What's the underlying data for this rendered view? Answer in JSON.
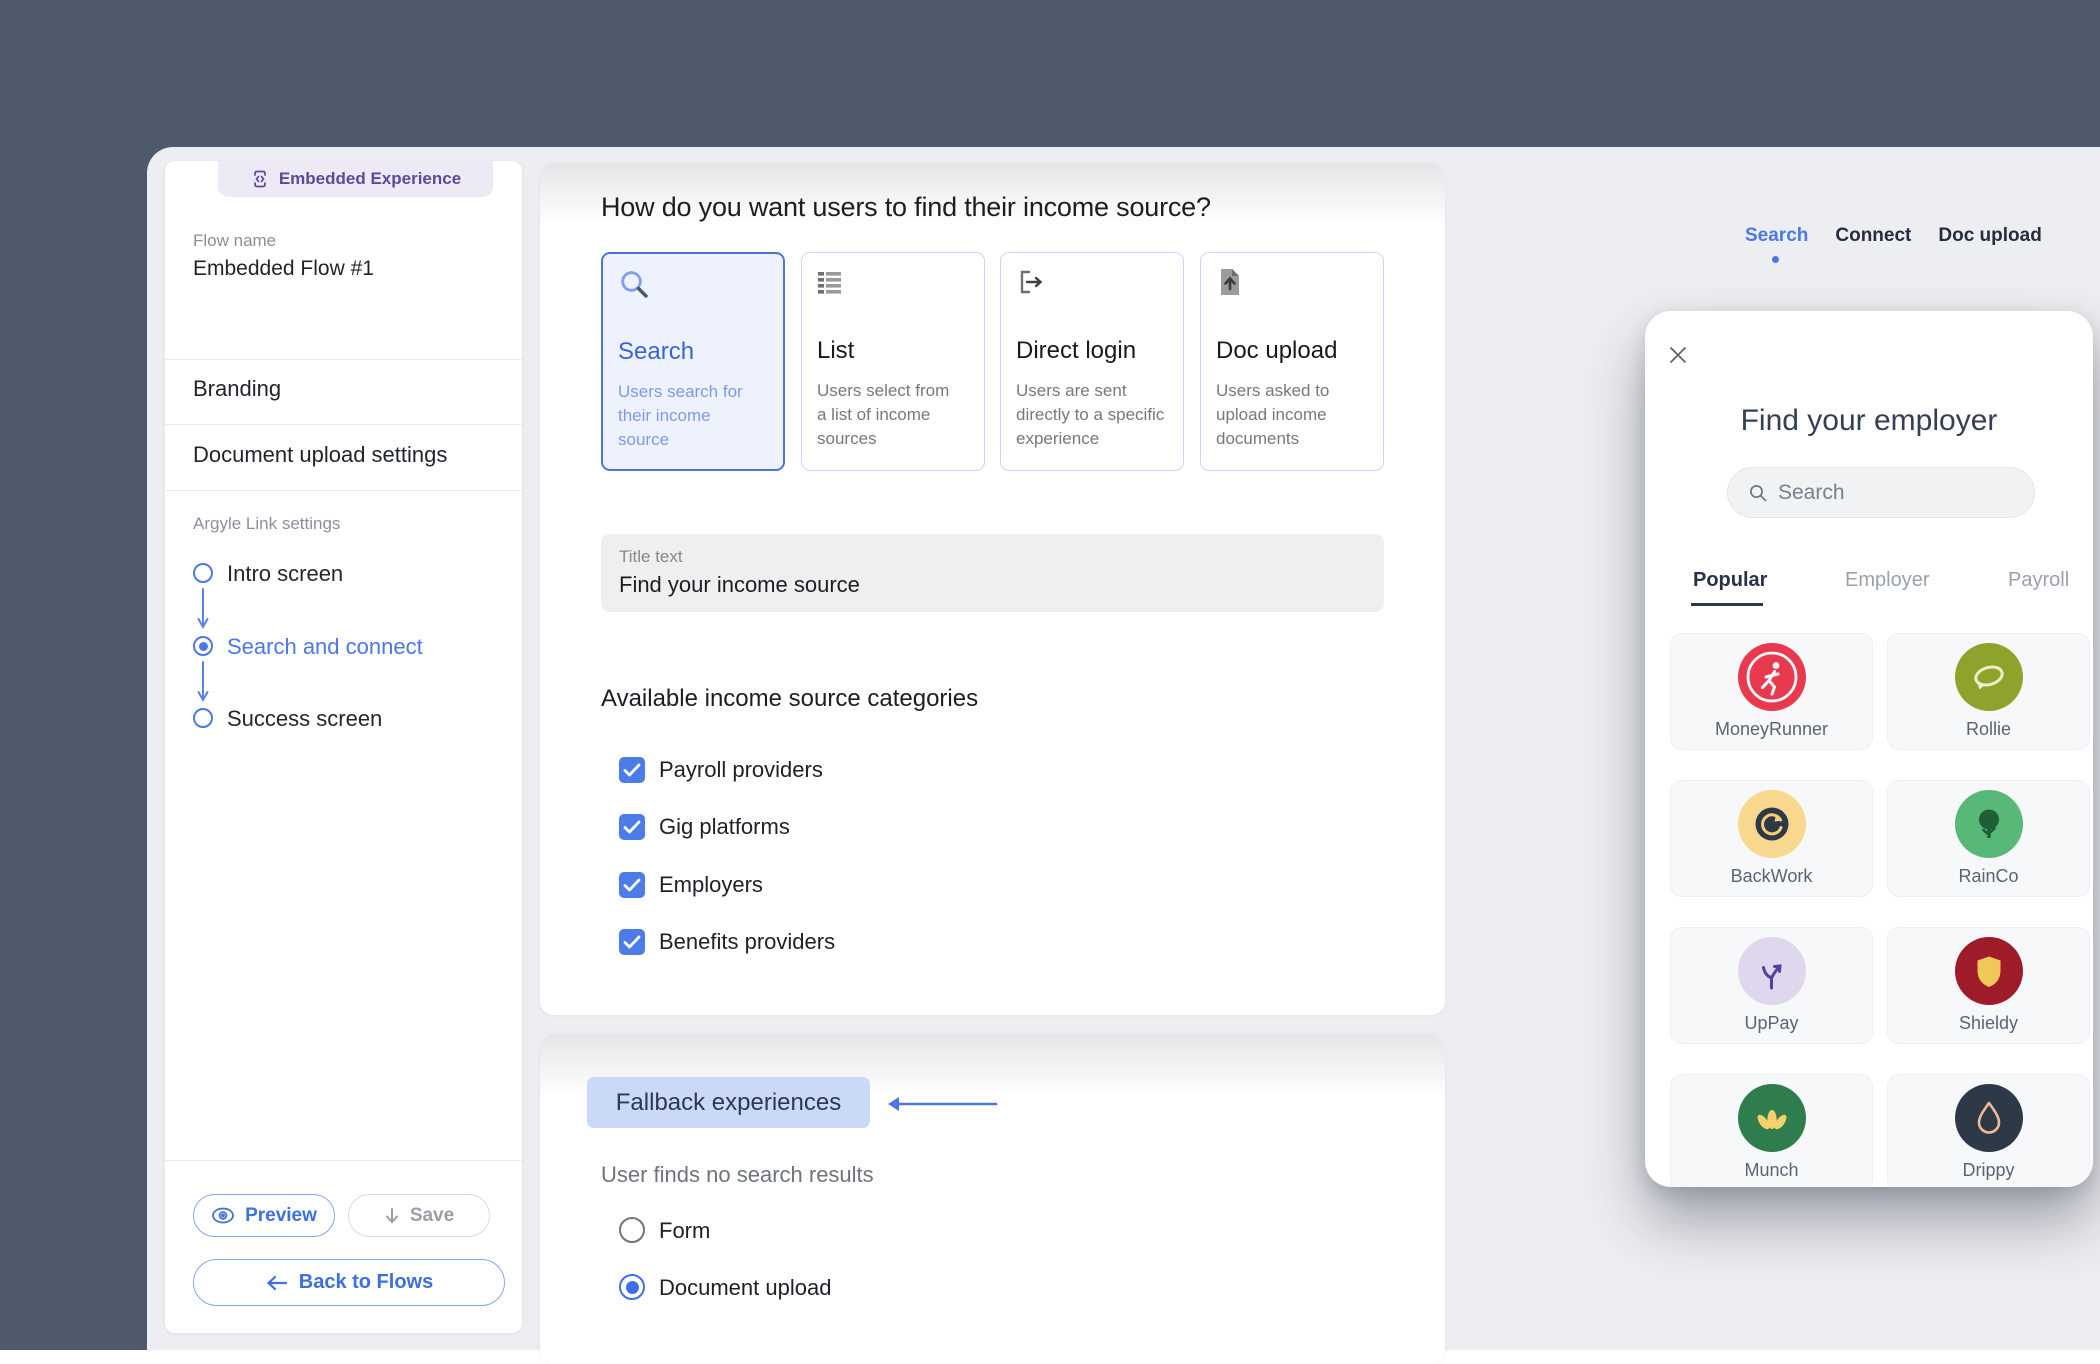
{
  "colors": {
    "background_slate": "#4e5a6a",
    "workspace_gray": "#edeef1",
    "accent_blue": "#4b78e6",
    "badge_purple": "#5c4a9c",
    "chip_blue": "#cbd9f8",
    "checkbox_blue": "#4c7ce8",
    "navy_text": "#333f54"
  },
  "sidebar": {
    "badge": "Embedded Experience",
    "flow_name_label": "Flow name",
    "flow_name_value": "Embedded Flow #1",
    "nav": [
      "Branding",
      "Document upload settings"
    ],
    "settings_label": "Argyle Link settings",
    "steps": [
      {
        "label": "Intro screen"
      },
      {
        "label": "Search and connect"
      },
      {
        "label": "Success screen"
      }
    ],
    "preview_button": "Preview",
    "save_button": "Save",
    "back_button": "Back to Flows"
  },
  "main": {
    "heading": "How do you want users to find their income source?",
    "options": [
      {
        "title": "Search",
        "desc": "Users search for their income source"
      },
      {
        "title": "List",
        "desc": "Users select from a list of income sources"
      },
      {
        "title": "Direct login",
        "desc": "Users are sent directly to a specific experience"
      },
      {
        "title": "Doc upload",
        "desc": "Users asked to upload income documents"
      }
    ],
    "title_field_label": "Title text",
    "title_field_value": "Find your income source",
    "categories_heading": "Available income source categories",
    "categories": [
      "Payroll providers",
      "Gig platforms",
      "Employers",
      "Benefits providers"
    ],
    "fallback_heading": "Fallback experiences",
    "fallback_subtitle": "User finds no search results",
    "fallback_options": [
      "Form",
      "Document upload"
    ]
  },
  "preview_pane": {
    "tabs": [
      "Search",
      "Connect",
      "Doc upload"
    ],
    "title": "Find your employer",
    "search_placeholder": "Search",
    "category_tabs": [
      "Popular",
      "Employer",
      "Payroll"
    ],
    "employers": [
      {
        "name": "MoneyRunner",
        "color": "#e8394f"
      },
      {
        "name": "Rollie",
        "color": "#8da32c"
      },
      {
        "name": "BackWork",
        "color": "#f8d88e"
      },
      {
        "name": "RainCo",
        "color": "#57b877"
      },
      {
        "name": "UpPay",
        "color": "#ded7ee"
      },
      {
        "name": "Shieldy",
        "color": "#9e1b29"
      },
      {
        "name": "Munch",
        "color": "#2f7d4f"
      },
      {
        "name": "Drippy",
        "color": "#2e3947"
      }
    ]
  }
}
